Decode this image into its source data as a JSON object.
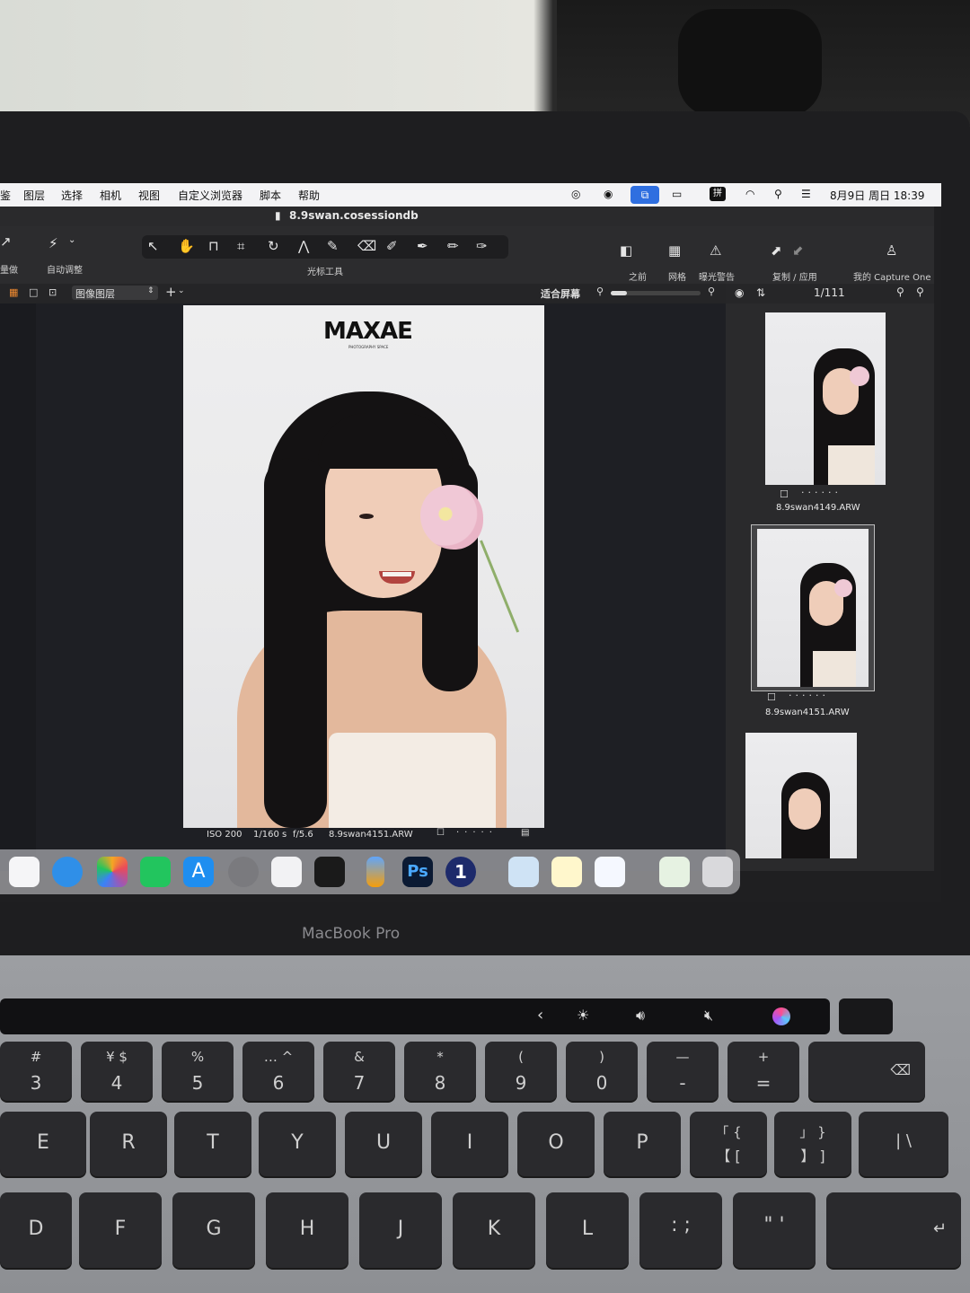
{
  "menubar": {
    "items": [
      "鉴",
      "图层",
      "选择",
      "相机",
      "视图",
      "自定义浏览器",
      "脚本",
      "帮助"
    ],
    "date_time": "8月9日 周日 18:39"
  },
  "window": {
    "title": "8.9swan.cosessiondb"
  },
  "toolbar": {
    "left_label": "量做",
    "auto_adjust_label": "自动调整",
    "cursor_tools_label": "光标工具",
    "before_label": "之前",
    "grid_label": "网格",
    "exposure_warning_label": "曝光警告",
    "copy_apply_label": "复制 / 应用",
    "my_capture_one_label": "我的 Capture One"
  },
  "subbar": {
    "layer_select": "图像图层",
    "fit_screen_label": "适合屏幕",
    "browser_count": "1/111"
  },
  "viewer": {
    "logo_text": "MAXAE",
    "logo_sub": "PHOTOGRAPHY SPACE",
    "meta": {
      "iso": "ISO 200",
      "shutter": "1/160 s",
      "aperture": "f/5.6",
      "filename": "8.9swan4151.ARW"
    }
  },
  "browser": {
    "thumbs": [
      {
        "filename": "8.9swan4149.ARW",
        "selected": false
      },
      {
        "filename": "8.9swan4151.ARW",
        "selected": true
      },
      {
        "filename": "",
        "selected": false
      }
    ]
  },
  "dock": {
    "apps": [
      "launchpad-icon",
      "safari-icon",
      "photos-icon",
      "wechat-icon",
      "app-store-icon",
      "system-settings-icon",
      "freeform-icon",
      "preview-icon",
      "pencil-app-icon",
      "photoshop-icon",
      "capture-one-icon",
      "finder-image-icon",
      "notes-icon",
      "cloud-drive-icon",
      "pasteboard-icon",
      "trash-icon"
    ],
    "photoshop_text": "Ps",
    "capture_one_text": "1"
  },
  "laptop": {
    "brand": "MacBook Pro"
  },
  "keyboard": {
    "row1": [
      {
        "upper": "#",
        "lower": "3"
      },
      {
        "upper": "¥ $",
        "lower": "4"
      },
      {
        "upper": "%",
        "lower": "5"
      },
      {
        "upper": "… ^",
        "lower": "6"
      },
      {
        "upper": "&",
        "lower": "7"
      },
      {
        "upper": "*",
        "lower": "8"
      },
      {
        "upper": "(",
        "lower": "9"
      },
      {
        "upper": ")",
        "lower": "0"
      },
      {
        "upper": "—",
        "lower": "-"
      },
      {
        "upper": "+",
        "lower": "="
      }
    ],
    "row2": [
      "E",
      "R",
      "T",
      "Y",
      "U",
      "I",
      "O",
      "P"
    ],
    "row2_brackets": [
      {
        "upper": "「 {",
        "lower": "【 ["
      },
      {
        "upper": "」 }",
        "lower": "】 ]"
      }
    ],
    "row3": [
      "D",
      "F",
      "G",
      "H",
      "J",
      "K",
      "L"
    ]
  },
  "colors": {
    "menubar_bg": "#f3f3f5",
    "app_bg": "#2b2b2d",
    "viewer_bg": "#1e1f24",
    "keyboard_key": "#2a2a2d",
    "deck": "#9c9ea2"
  }
}
